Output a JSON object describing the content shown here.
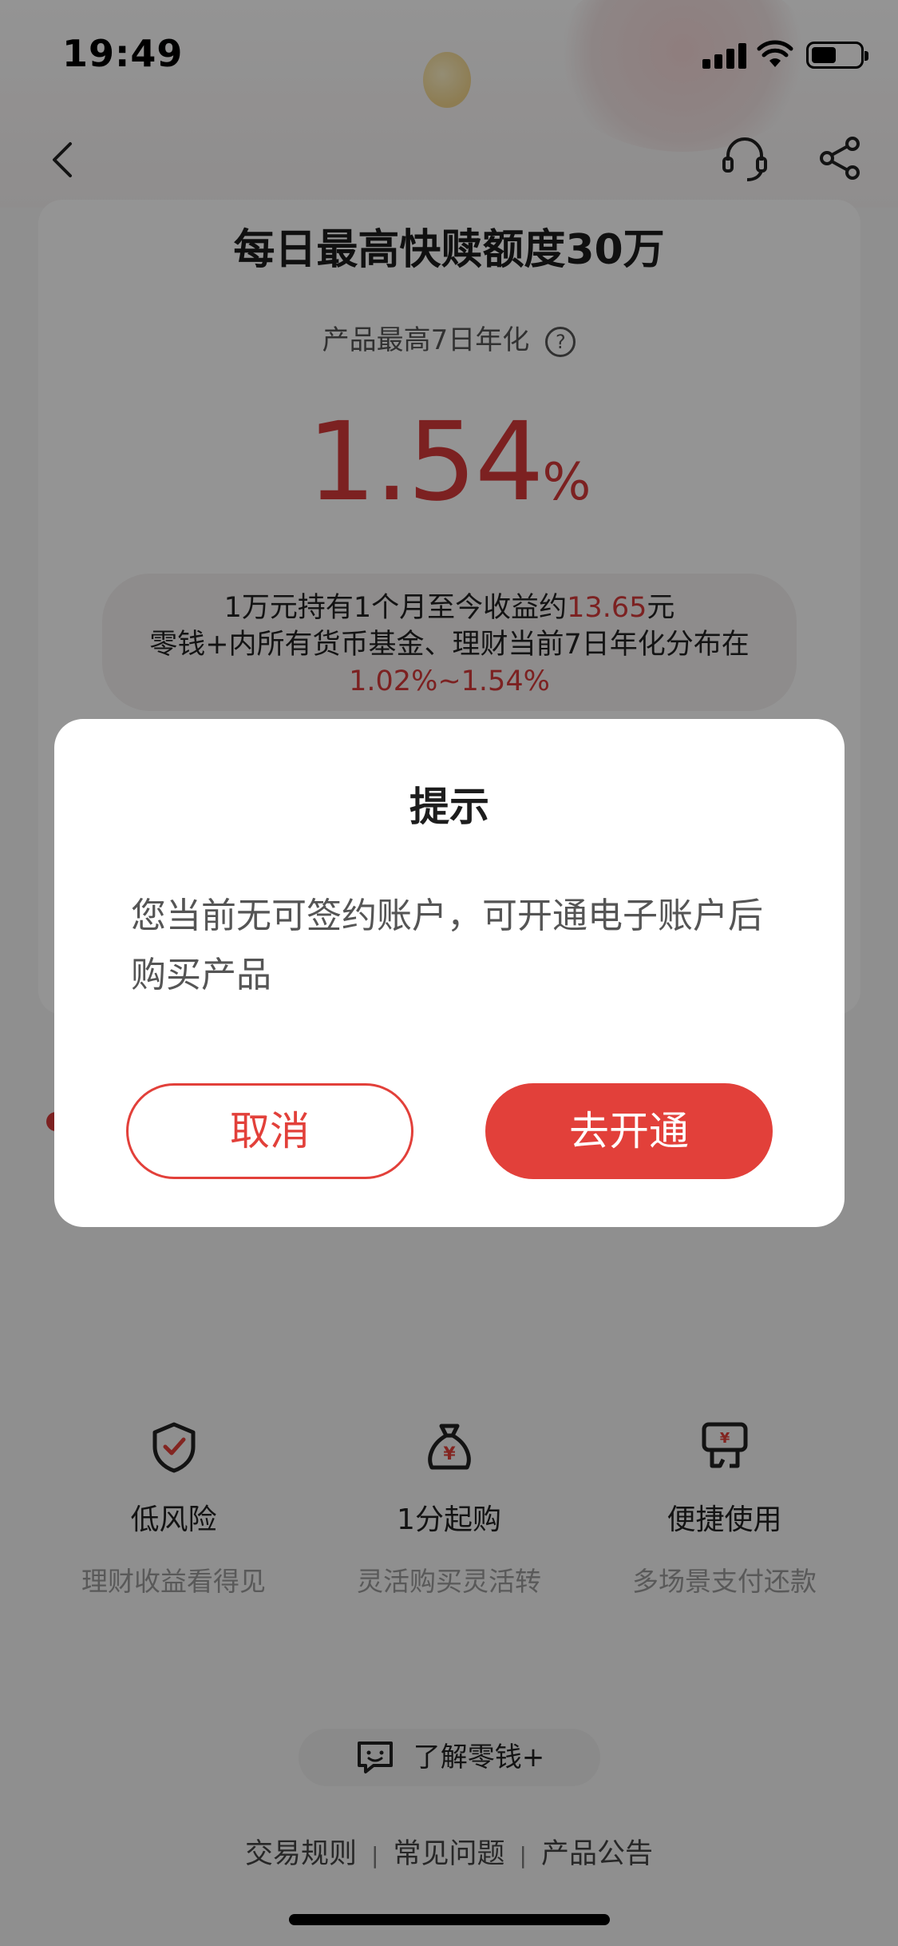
{
  "status_bar": {
    "time": "19:49"
  },
  "product": {
    "headline": "每日最高快赎额度30万",
    "rate_label": "产品最高7日年化",
    "rate_value": "1.54",
    "rate_unit": "%",
    "info": {
      "line1_prefix": "1万元持有1个月至今收益约",
      "line1_amount": "13.65",
      "line1_suffix": "元",
      "line2": "零钱+内所有货币基金、理财当前7日年化分布在",
      "range": "1.02%~1.54%"
    }
  },
  "features": [
    {
      "icon": "shield-check-icon",
      "title": "低风险",
      "subtitle": "理财收益看得见"
    },
    {
      "icon": "money-bag-icon",
      "title": "1分起购",
      "subtitle": "灵活购买灵活转"
    },
    {
      "icon": "payment-card-icon",
      "title": "便捷使用",
      "subtitle": "多场景支付还款"
    }
  ],
  "learn_more": {
    "label": "了解零钱+"
  },
  "footer": {
    "links": [
      "交易规则",
      "常见问题",
      "产品公告"
    ]
  },
  "dialog": {
    "title": "提示",
    "message": "您当前无可签约账户，可开通电子账户后购买产品",
    "cancel_label": "取消",
    "confirm_label": "去开通"
  },
  "colors": {
    "accent": "#e2403a",
    "rate_red": "#d63a3a"
  }
}
